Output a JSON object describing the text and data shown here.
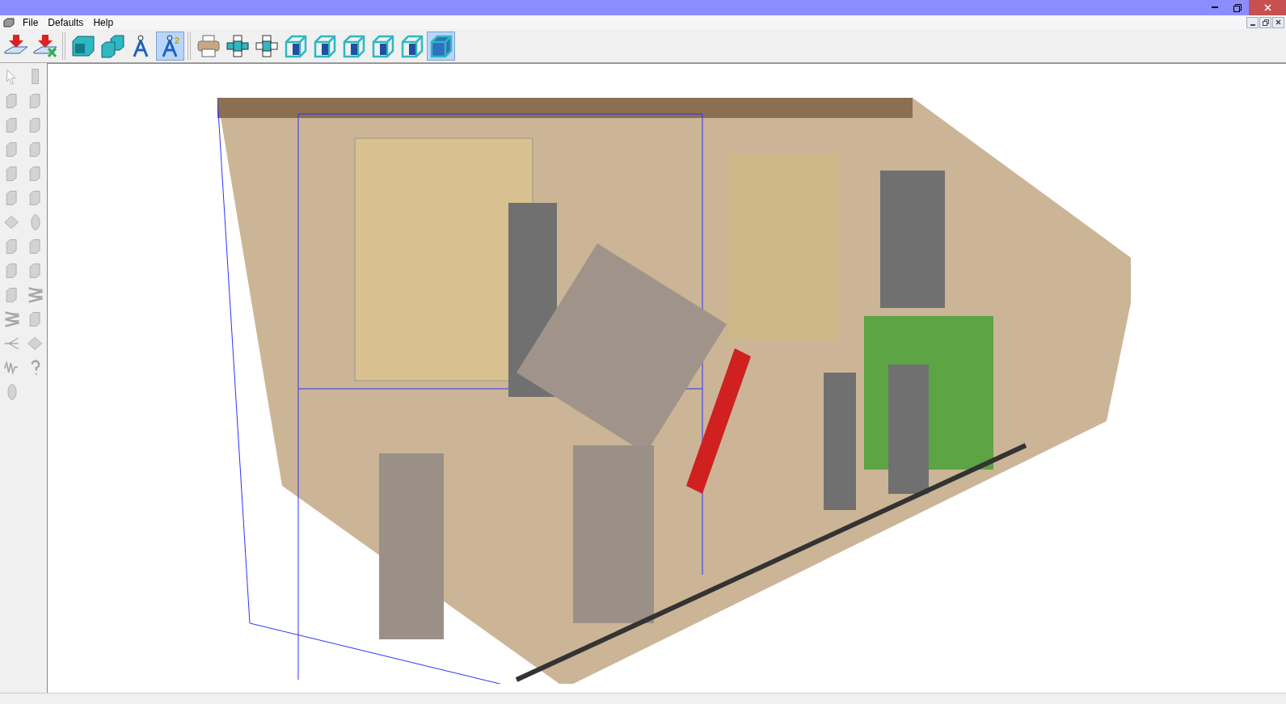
{
  "menu": [
    {
      "label": "File"
    },
    {
      "label": "Defaults"
    },
    {
      "label": "Help"
    }
  ],
  "toolbar": [
    {
      "kind": "import",
      "selected": false
    },
    {
      "kind": "import-cancel",
      "selected": false
    },
    {
      "kind": "separator"
    },
    {
      "kind": "box",
      "selected": false
    },
    {
      "kind": "box-pair",
      "selected": false
    },
    {
      "kind": "compass",
      "selected": false
    },
    {
      "kind": "compass-two",
      "badge": "2",
      "selected": true
    },
    {
      "kind": "separator"
    },
    {
      "kind": "printer",
      "selected": false
    },
    {
      "kind": "section",
      "selected": false
    },
    {
      "kind": "section-outline",
      "selected": false
    },
    {
      "kind": "wireframe",
      "selected": false
    },
    {
      "kind": "wireframe",
      "selected": false
    },
    {
      "kind": "wireframe",
      "selected": false
    },
    {
      "kind": "wireframe",
      "selected": false
    },
    {
      "kind": "wireframe",
      "selected": false
    },
    {
      "kind": "solid",
      "selected": true
    }
  ],
  "palette": [
    {
      "kind": "arrow",
      "disabled": true
    },
    {
      "kind": "door",
      "disabled": true
    },
    {
      "kind": "module",
      "disabled": true
    },
    {
      "kind": "module",
      "disabled": true
    },
    {
      "kind": "module",
      "disabled": true
    },
    {
      "kind": "module",
      "disabled": true
    },
    {
      "kind": "module",
      "disabled": true
    },
    {
      "kind": "module",
      "disabled": true
    },
    {
      "kind": "module",
      "disabled": true
    },
    {
      "kind": "module",
      "disabled": true
    },
    {
      "kind": "module",
      "disabled": true
    },
    {
      "kind": "module",
      "disabled": true
    },
    {
      "kind": "panel",
      "disabled": true
    },
    {
      "kind": "disc",
      "disabled": true
    },
    {
      "kind": "module",
      "disabled": true
    },
    {
      "kind": "module",
      "disabled": true
    },
    {
      "kind": "module",
      "disabled": true
    },
    {
      "kind": "module",
      "disabled": true
    },
    {
      "kind": "module",
      "disabled": true
    },
    {
      "kind": "coil",
      "disabled": true
    },
    {
      "kind": "coil",
      "disabled": true
    },
    {
      "kind": "module",
      "disabled": true
    },
    {
      "kind": "spray",
      "disabled": true
    },
    {
      "kind": "panel",
      "disabled": true
    },
    {
      "kind": "spring",
      "disabled": true
    },
    {
      "kind": "help",
      "disabled": true
    },
    {
      "kind": "disc",
      "disabled": true
    }
  ]
}
